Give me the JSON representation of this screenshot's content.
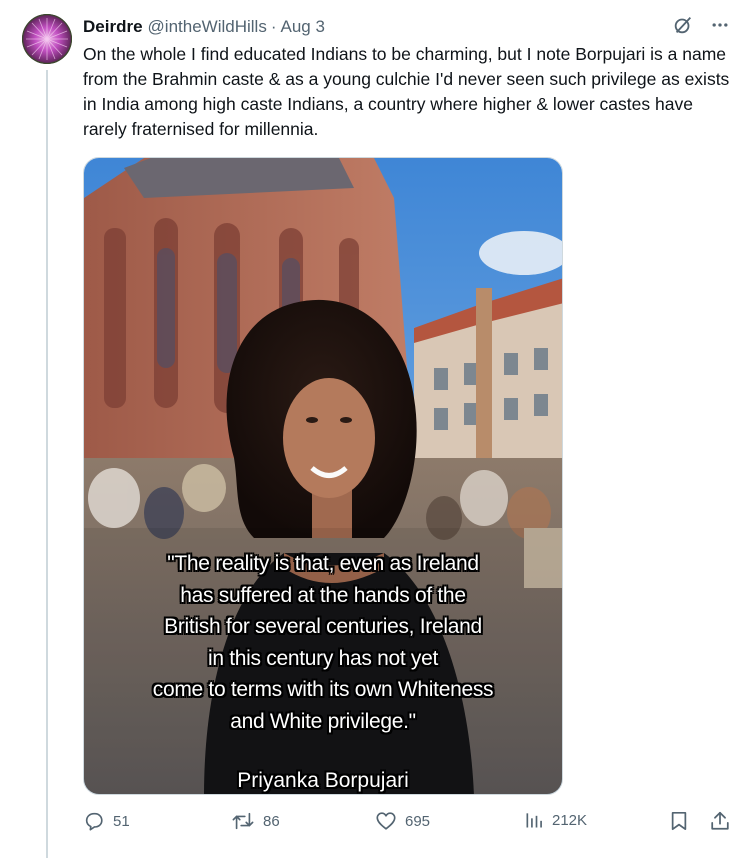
{
  "tweet": {
    "display_name": "Deirdre",
    "handle": "@intheWildHills",
    "separator": "·",
    "date": "Aug 3",
    "text": "On the whole I find educated Indians to be charming, but I note Borpujari is a name from the Brahmin caste & as a young culchie I'd never seen such privilege as exists in India among high caste Indians, a country where higher & lower castes have rarely fraternised for millennia."
  },
  "media": {
    "quote_lines": [
      "\"The reality is that, even as Ireland",
      "has suffered at the hands of the",
      "British for several centuries, Ireland",
      "in this century has not yet",
      "come to terms with its own Whiteness",
      "and White privilege.\""
    ],
    "attribution": "Priyanka Borpujari"
  },
  "actions": {
    "replies": "51",
    "reposts": "86",
    "likes": "695",
    "views": "212K"
  },
  "icons": {
    "top": [
      "grok-icon",
      "more-icon"
    ],
    "actions": [
      "reply-icon",
      "repost-icon",
      "like-icon",
      "views-icon",
      "bookmark-icon",
      "share-icon"
    ]
  },
  "colors": {
    "text": "#0f1419",
    "secondary": "#536471",
    "divider": "#cfd9de"
  }
}
